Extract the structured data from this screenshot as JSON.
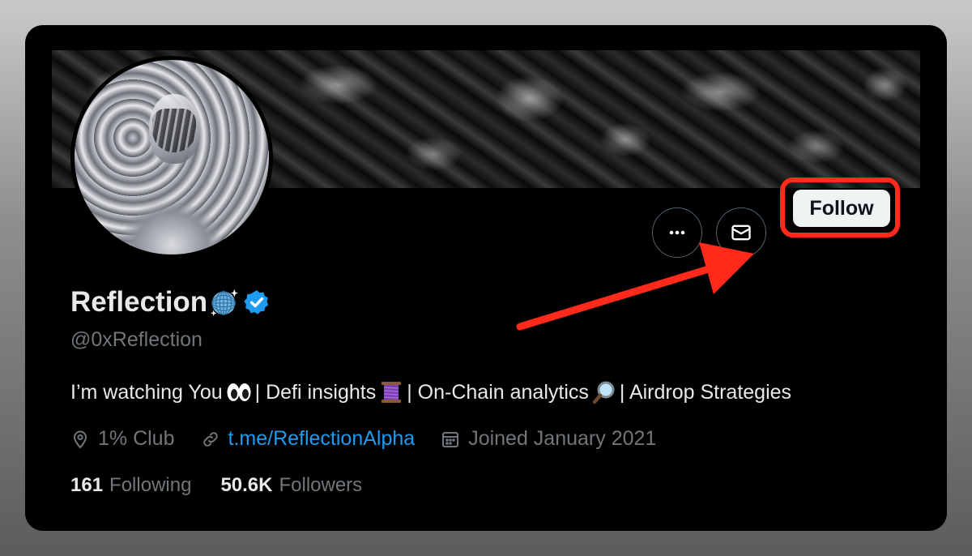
{
  "profile": {
    "display_name": "Reflection",
    "handle": "@0xReflection",
    "bio": {
      "part1": "I’m watching You",
      "part2": "| Defi insights",
      "part3": "| On-Chain analytics",
      "part4": "| Airdrop Strategies"
    },
    "location": "1% Club",
    "website": "t.me/ReflectionAlpha",
    "joined": "Joined January 2021",
    "following_count": "161",
    "following_label": "Following",
    "followers_count": "50.6K",
    "followers_label": "Followers"
  },
  "actions": {
    "follow_label": "Follow"
  },
  "icons": {
    "more": "more-icon",
    "message": "message-icon",
    "location": "location-icon",
    "link": "link-icon",
    "calendar": "calendar-icon",
    "verified": "verified-badge-icon"
  },
  "colors": {
    "accent": "#1d9bf0",
    "highlight": "#ff2a1a",
    "muted": "#71767b"
  }
}
